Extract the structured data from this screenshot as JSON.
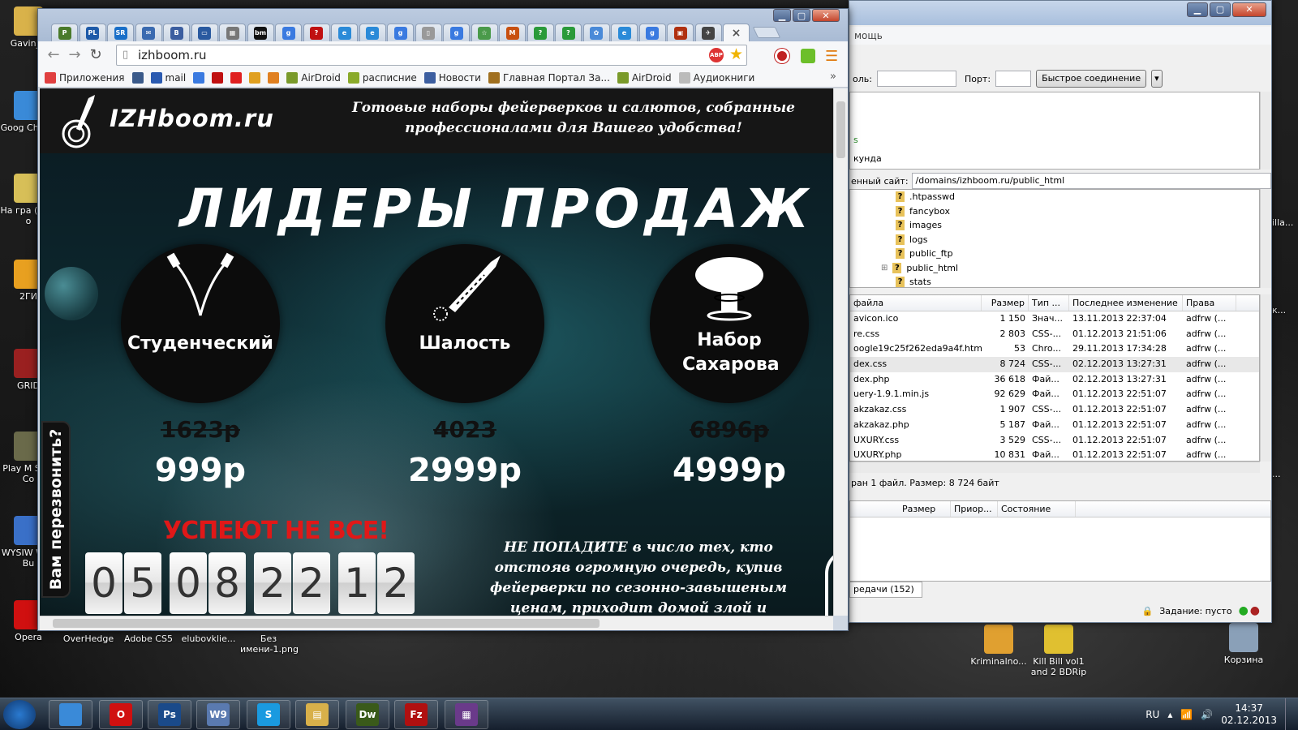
{
  "desktop": {
    "icons": [
      {
        "label": "Gavin_K",
        "color": "#d9b24a"
      },
      {
        "label": "Goog Chrom",
        "color": "#3a8ad8"
      },
      {
        "label": "На гра (Man o",
        "color": "#d7bf58"
      },
      {
        "label": "2ГИ",
        "color": "#e8a020"
      },
      {
        "label": "GRID",
        "color": "#9a2020"
      },
      {
        "label": "Play M Slug Co",
        "color": "#6a6a4a"
      },
      {
        "label": "WYSIW Web Bu",
        "color": "#3a70c8"
      },
      {
        "label": "Opera",
        "color": "#d01010"
      },
      {
        "label": "OverHedge",
        "color": "#333"
      },
      {
        "label": "Adobe CS5",
        "color": "#333"
      },
      {
        "label": "elubovklie...",
        "color": "#333"
      },
      {
        "label": "Без имени-1.png",
        "color": "#333"
      },
      {
        "label": "Kriminalno...",
        "color": "#e0a030"
      },
      {
        "label": "Kill Bill vol1 and 2 BDRip",
        "color": "#e0c030"
      },
      {
        "label": "Корзина",
        "color": "#8aa0b8"
      }
    ],
    "right_cut_labels": [
      "illa...",
      "к...",
      "..."
    ]
  },
  "filezilla": {
    "menu": "мощь",
    "password_label": "оль:",
    "port_label": "Порт:",
    "quick_connect": "Быстрое соединение",
    "log_line1": "s",
    "log_line2": "кунда",
    "remote_site_label": "енный сайт:",
    "remote_path": "/domains/izhboom.ru/public_html",
    "tree": [
      ".htpasswd",
      "fancybox",
      "images",
      "logs",
      "public_ftp",
      "public_html",
      "stats"
    ],
    "columns": [
      "файла",
      "Размер",
      "Тип ...",
      "Последнее изменение",
      "Права"
    ],
    "files": [
      [
        "avicon.ico",
        "1 150",
        "Знач...",
        "13.11.2013 22:37:04",
        "adfrw (..."
      ],
      [
        "re.css",
        "2 803",
        "CSS-...",
        "01.12.2013 21:51:06",
        "adfrw (..."
      ],
      [
        "oogle19c25f262eda9a4f.html",
        "53",
        "Chro...",
        "29.11.2013 17:34:28",
        "adfrw (..."
      ],
      [
        "dex.css",
        "8 724",
        "CSS-...",
        "02.12.2013 13:27:31",
        "adfrw (..."
      ],
      [
        "dex.php",
        "36 618",
        "Фай...",
        "02.12.2013 13:27:31",
        "adfrw (..."
      ],
      [
        "uery-1.9.1.min.js",
        "92 629",
        "Фай...",
        "01.12.2013 22:51:07",
        "adfrw (..."
      ],
      [
        "akzakaz.css",
        "1 907",
        "CSS-...",
        "01.12.2013 22:51:07",
        "adfrw (..."
      ],
      [
        "akzakaz.php",
        "5 187",
        "Фай...",
        "01.12.2013 22:51:07",
        "adfrw (..."
      ],
      [
        "UXURY.css",
        "3 529",
        "CSS-...",
        "01.12.2013 22:51:07",
        "adfrw (..."
      ],
      [
        "UXURY.php",
        "10 831",
        "Фай...",
        "01.12.2013 22:51:07",
        "adfrw (..."
      ]
    ],
    "status": "ран 1 файл. Размер: 8 724 байт",
    "queue_columns": [
      "Размер",
      "Приор...",
      "Состояние"
    ],
    "queue_tab": "редачи (152)",
    "task": "Задание: пусто"
  },
  "chrome": {
    "url": "izhboom.ru",
    "tabs": [
      {
        "t": "P",
        "c": "#4a7a2a"
      },
      {
        "t": "PL",
        "c": "#1e5aa8"
      },
      {
        "t": "SR",
        "c": "#1a6fc8"
      },
      {
        "t": "✉",
        "c": "#3a6ab0"
      },
      {
        "t": "B",
        "c": "#3c5ea0"
      },
      {
        "t": "▭",
        "c": "#2a5aa0"
      },
      {
        "t": "▦",
        "c": "#777"
      },
      {
        "t": "bm",
        "c": "#111"
      },
      {
        "t": "g",
        "c": "#3a7ae0"
      },
      {
        "t": "?",
        "c": "#c01010"
      },
      {
        "t": "e",
        "c": "#2a8ad8"
      },
      {
        "t": "e",
        "c": "#2a8ad8"
      },
      {
        "t": "g",
        "c": "#3a7ae0"
      },
      {
        "t": "▯",
        "c": "#999"
      },
      {
        "t": "g",
        "c": "#3a7ae0"
      },
      {
        "t": "☆",
        "c": "#4a9a4a"
      },
      {
        "t": "M",
        "c": "#c85010"
      },
      {
        "t": "?",
        "c": "#2a9a3a"
      },
      {
        "t": "?",
        "c": "#2a9a3a"
      },
      {
        "t": "✿",
        "c": "#4a8ad8"
      },
      {
        "t": "e",
        "c": "#2a8ad8"
      },
      {
        "t": "g",
        "c": "#3a7ae0"
      },
      {
        "t": "▣",
        "c": "#b03010"
      },
      {
        "t": "✈",
        "c": "#444"
      },
      {
        "t": "×",
        "c": "#777"
      }
    ],
    "bookmarks": [
      {
        "label": "Приложения",
        "c": "#e04040"
      },
      {
        "label": "",
        "c": "#3a5a8a"
      },
      {
        "label": "mail",
        "c": "#2a5ab0"
      },
      {
        "label": "",
        "c": "#3a7ae0"
      },
      {
        "label": "",
        "c": "#c01010"
      },
      {
        "label": "",
        "c": "#e02020"
      },
      {
        "label": "",
        "c": "#e0a020"
      },
      {
        "label": "",
        "c": "#e08020"
      },
      {
        "label": "AirDroid",
        "c": "#7a9a2a"
      },
      {
        "label": "расписние",
        "c": "#8aaa2a"
      },
      {
        "label": "Новости",
        "c": "#3c5ea0"
      },
      {
        "label": "Главная Портал За...",
        "c": "#a07020"
      },
      {
        "label": "AirDroid",
        "c": "#7a9a2a"
      },
      {
        "label": "Аудиокниги",
        "c": "#bbb"
      }
    ],
    "more": "»"
  },
  "site": {
    "logo": "IZHboom.ru",
    "tagline": "Готовые наборы фейерверков и салютов, собранные профессионалами для Вашего удобства!",
    "headline": "ЛИДЕРЫ ПРОДАЖ В ИЖЕ",
    "callback": "Вам перезвонить?",
    "products": [
      {
        "name": "Студенческий",
        "old": "1623р",
        "new": "999р"
      },
      {
        "name": "Шалость",
        "old": "4023",
        "new": "2999р"
      },
      {
        "name": "Набор Сахарова",
        "old": "6896р",
        "new": "4999р"
      }
    ],
    "hurry": "УСПЕЮТ НЕ ВСЕ!",
    "countdown": [
      "0",
      "5",
      "0",
      "8",
      "2",
      "2",
      "1",
      "2"
    ],
    "promo": "НЕ ПОПАДИТЕ в число тех, кто отстояв огромную очередь, купив фейерверки по сезонно-завышеным ценам, приходит домой злой и разочаровывается в"
  },
  "taskbar": {
    "apps": [
      {
        "t": "",
        "c": "#3a8ad8"
      },
      {
        "t": "O",
        "c": "#d01010"
      },
      {
        "t": "Ps",
        "c": "#1a4a8a"
      },
      {
        "t": "W9",
        "c": "#5a7ab0"
      },
      {
        "t": "S",
        "c": "#1a9ae0"
      },
      {
        "t": "▤",
        "c": "#d8b04a"
      },
      {
        "t": "Dw",
        "c": "#3a5a1a"
      },
      {
        "t": "Fz",
        "c": "#b01010"
      },
      {
        "t": "▦",
        "c": "#6a3a8a"
      }
    ],
    "lang": "RU",
    "time": "14:37",
    "date": "02.12.2013"
  }
}
